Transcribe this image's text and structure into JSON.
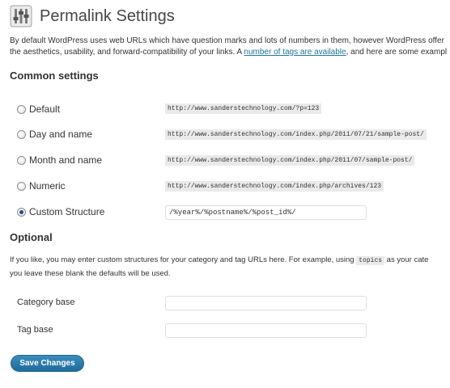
{
  "header": {
    "icon": "settings-icon",
    "title": "Permalink Settings"
  },
  "intro": {
    "line1": "By default WordPress uses web URLs which have question marks and lots of numbers in them, however WordPress offer",
    "line2_prefix": "the aesthetics, usability, and forward-compatibility of your links. A ",
    "link_text": "number of tags are available",
    "line2_suffix": ", and here are some exampl"
  },
  "common_settings": {
    "title": "Common settings",
    "options": [
      {
        "label": "Default",
        "sample": "http://www.sanderstechnology.com/?p=123",
        "checked": false
      },
      {
        "label": "Day and name",
        "sample": "http://www.sanderstechnology.com/index.php/2011/07/21/sample-post/",
        "checked": false
      },
      {
        "label": "Month and name",
        "sample": "http://www.sanderstechnology.com/index.php/2011/07/sample-post/",
        "checked": false
      },
      {
        "label": "Numeric",
        "sample": "http://www.sanderstechnology.com/index.php/archives/123",
        "checked": false
      }
    ],
    "custom": {
      "label": "Custom Structure",
      "value": "/%year%/%postname%/%post_id%/",
      "checked": true
    }
  },
  "optional": {
    "title": "Optional",
    "desc_line1_prefix": "If you like, you may enter custom structures for your category and tag URLs here. For example, using ",
    "desc_code": "topics",
    "desc_line1_suffix": " as your cate",
    "desc_line2": "you leave these blank the defaults will be used.",
    "category_base_label": "Category base",
    "category_base_value": "",
    "tag_base_label": "Tag base",
    "tag_base_value": ""
  },
  "actions": {
    "save_label": "Save Changes"
  },
  "colors": {
    "link": "#21759b",
    "button": "#2a7aae",
    "radio_checked": "#2a4b8d"
  }
}
